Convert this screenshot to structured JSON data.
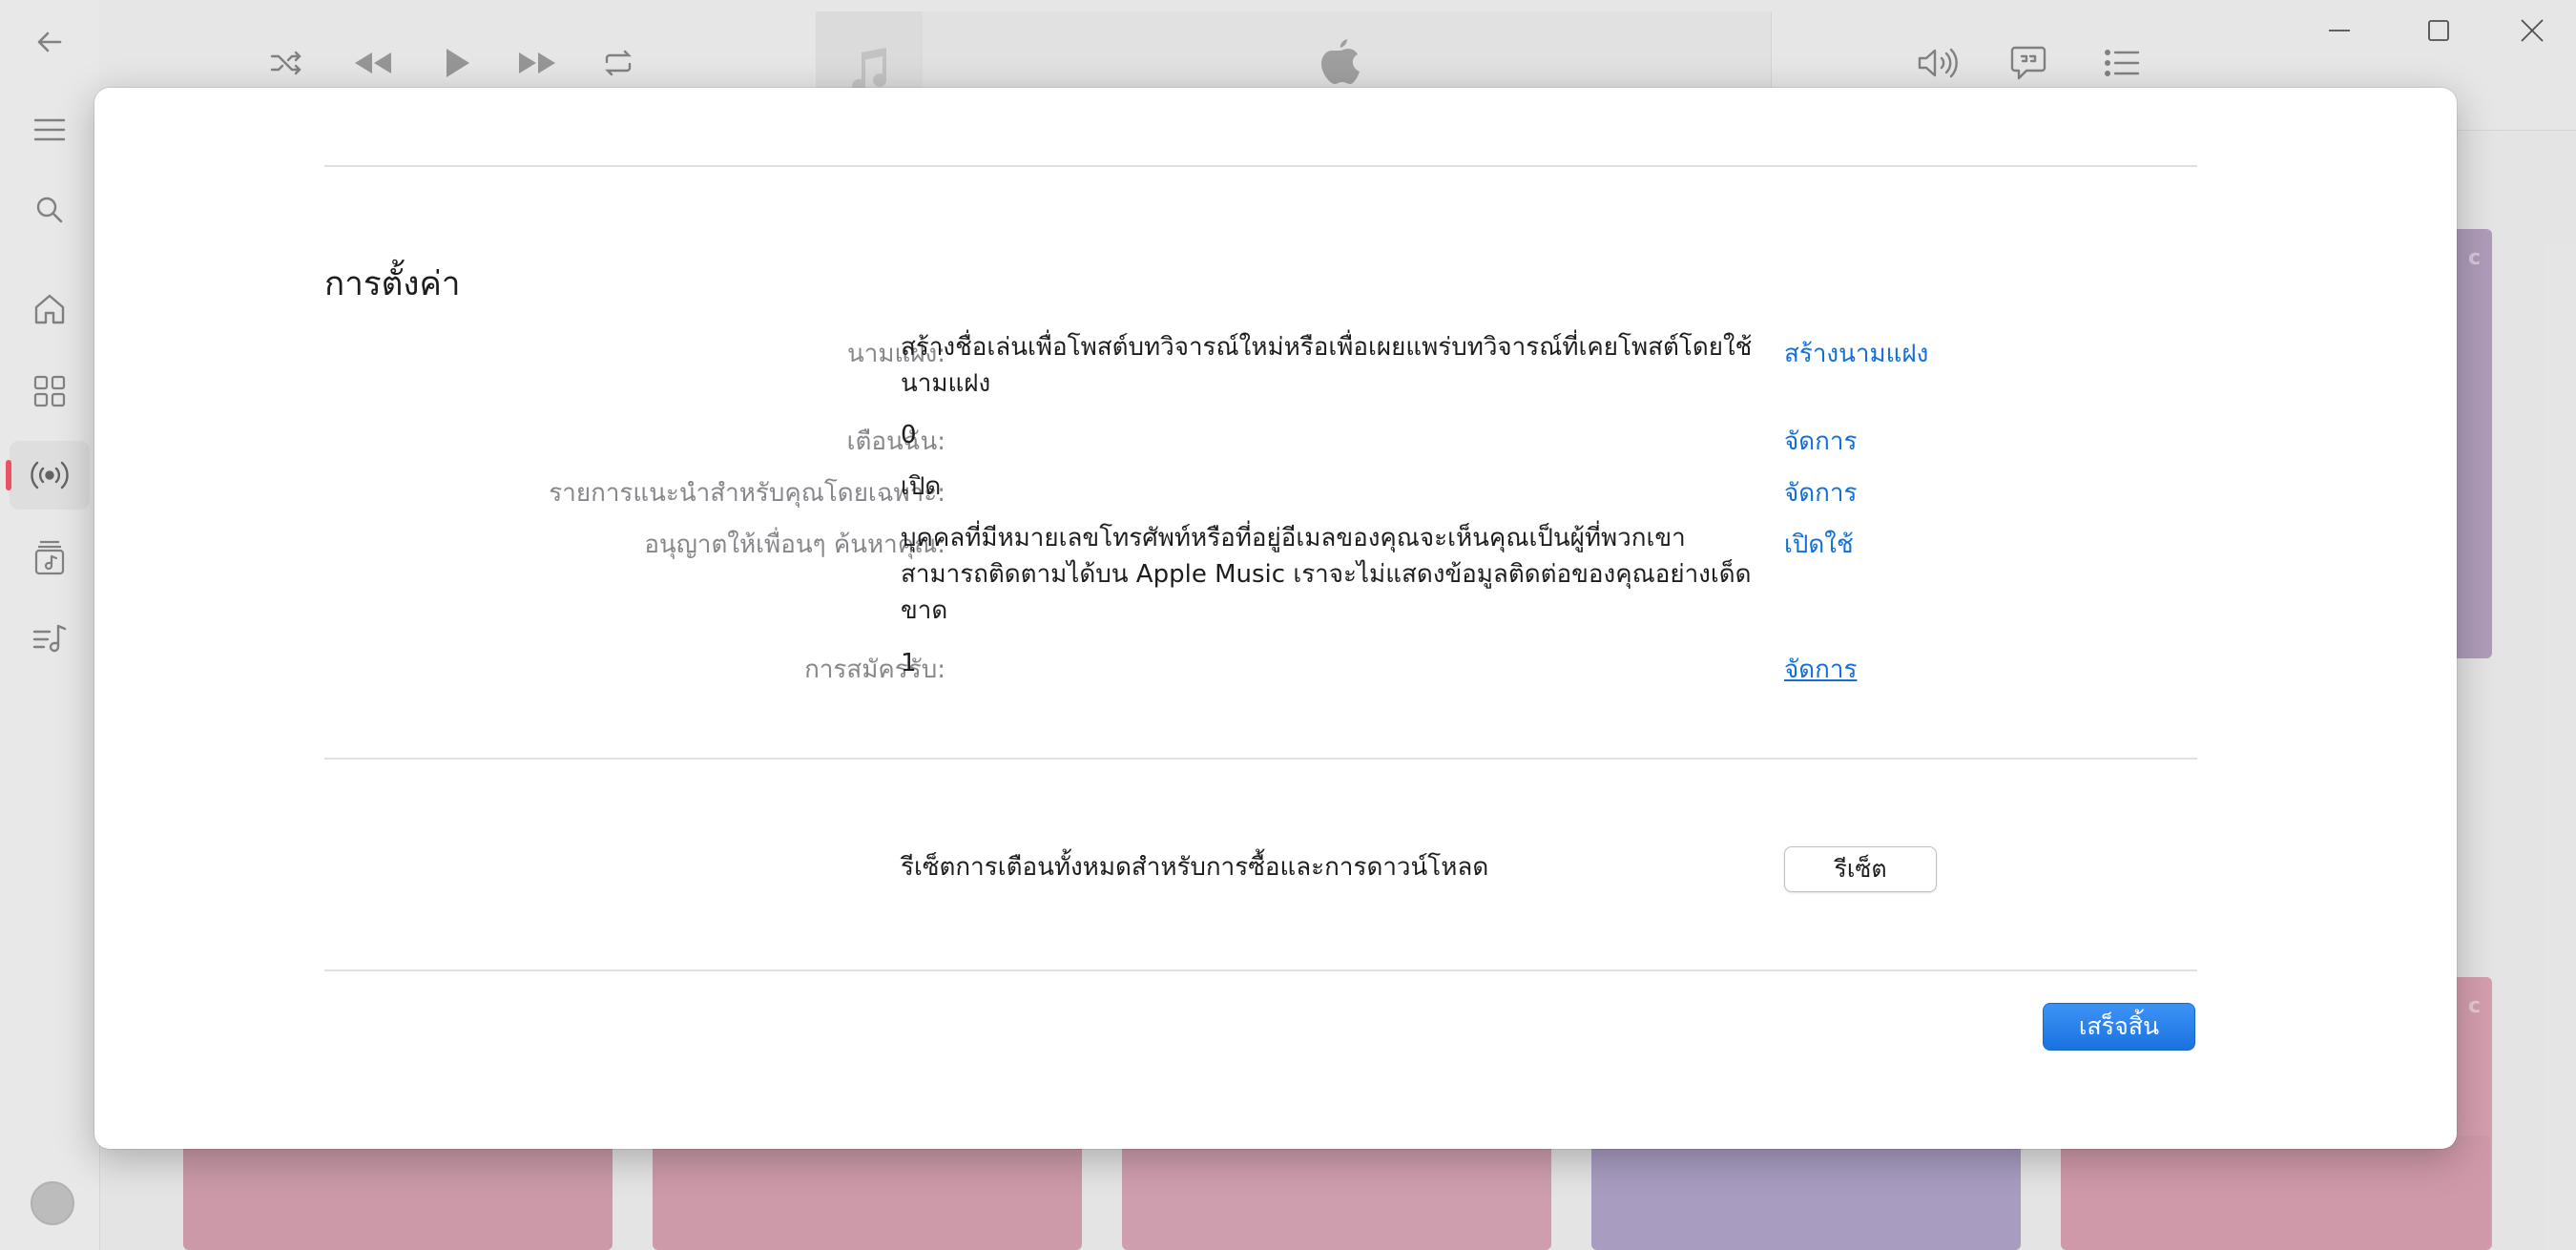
{
  "app": {
    "background_tile_tag": "c",
    "colors": {
      "accent": "#fa586a",
      "link": "#1470d6",
      "primary_button": "#1a72e0"
    }
  },
  "sidebar": {
    "items": [
      {
        "name": "back",
        "icon": "back-arrow-icon"
      },
      {
        "name": "menu",
        "icon": "hamburger-icon"
      },
      {
        "name": "search",
        "icon": "search-icon"
      },
      {
        "name": "home",
        "icon": "home-icon"
      },
      {
        "name": "browse",
        "icon": "grid-icon"
      },
      {
        "name": "radio",
        "icon": "radio-broadcast-icon",
        "active": true
      },
      {
        "name": "library",
        "icon": "library-icon"
      },
      {
        "name": "playlists",
        "icon": "playlist-icon"
      }
    ]
  },
  "player": {
    "controls": [
      "shuffle-icon",
      "previous-icon",
      "play-icon",
      "next-icon",
      "repeat-icon"
    ],
    "right_controls": [
      "volume-icon",
      "lyrics-icon",
      "queue-icon"
    ],
    "logo": "apple-logo-icon"
  },
  "settings": {
    "title": "การตั้งค่า",
    "rows": [
      {
        "label": "นามแฝง:",
        "value": "สร้างชื่อเล่นเพื่อโพสต์บทวิจารณ์ใหม่หรือเพื่อเผยแพร่บทวิจารณ์ที่เคยโพสต์โดยใช้นามแฝง",
        "action": "สร้างนามแฝง"
      },
      {
        "label": "เตือนฉัน:",
        "value": "0",
        "action": "จัดการ"
      },
      {
        "label": "รายการแนะนำสำหรับคุณโดยเฉพาะ:",
        "value": "เปิด",
        "action": "จัดการ"
      },
      {
        "label": "อนุญาตให้เพื่อนๆ ค้นหาคุณ:",
        "value": "บุคคลที่มีหมายเลขโทรศัพท์หรือที่อยู่อีเมลของคุณจะเห็นคุณเป็นผู้ที่พวกเขาสามารถติดตามได้บน Apple Music เราจะไม่แสดงข้อมูลติดต่อของคุณอย่างเด็ดขาด",
        "action": "เปิดใช้"
      },
      {
        "label": "การสมัครรับ:",
        "value": "1",
        "action": "จัดการ"
      }
    ],
    "reset_text": "รีเซ็ตการเตือนทั้งหมดสำหรับการซื้อและการดาวน์โหลด",
    "reset_button": "รีเซ็ต",
    "done_button": "เสร็จสิ้น"
  }
}
